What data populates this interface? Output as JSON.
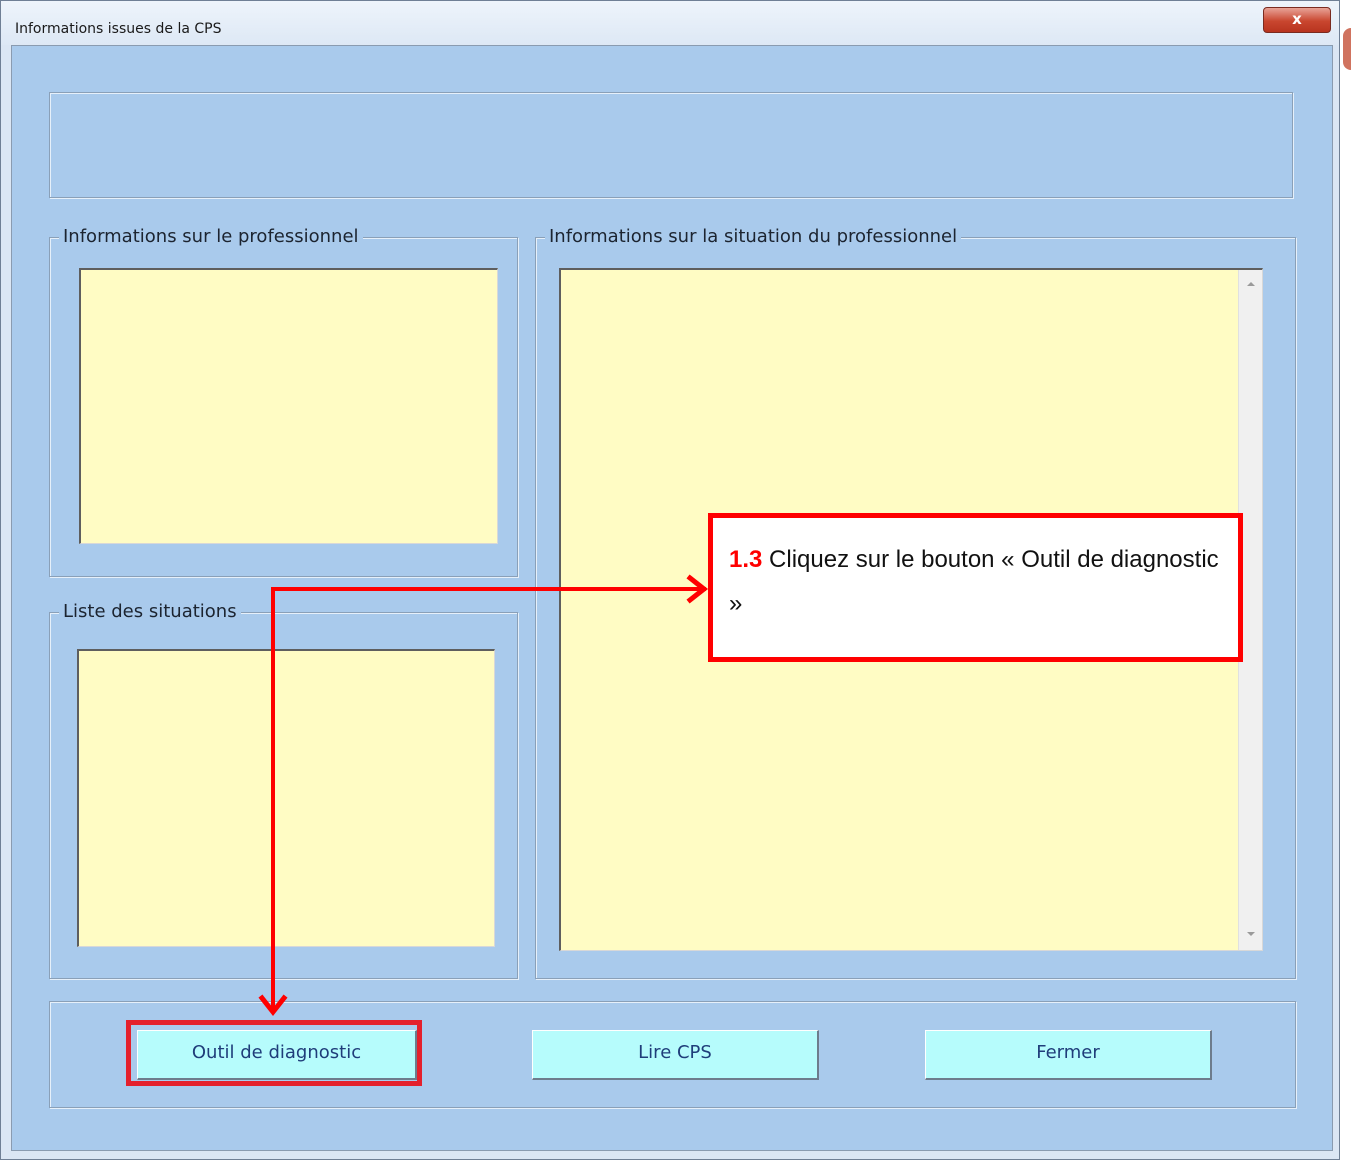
{
  "window": {
    "title": "Informations issues de la CPS",
    "close_glyph": "x"
  },
  "groups": {
    "professional_info": "Informations sur le professionnel",
    "situation_info": "Informations sur la situation du professionnel",
    "situations_list": "Liste des situations"
  },
  "buttons": {
    "diagnostic": "Outil de diagnostic",
    "read_cps": "Lire CPS",
    "close": "Fermer"
  },
  "annotation": {
    "step": "1.3",
    "text": "Cliquez sur le bouton « Outil de diagnostic »",
    "color": "#ff0000"
  },
  "colors": {
    "client_background": "#a9caec",
    "text_area_background": "#fffcc4",
    "button_background": "#b6fcfc"
  }
}
